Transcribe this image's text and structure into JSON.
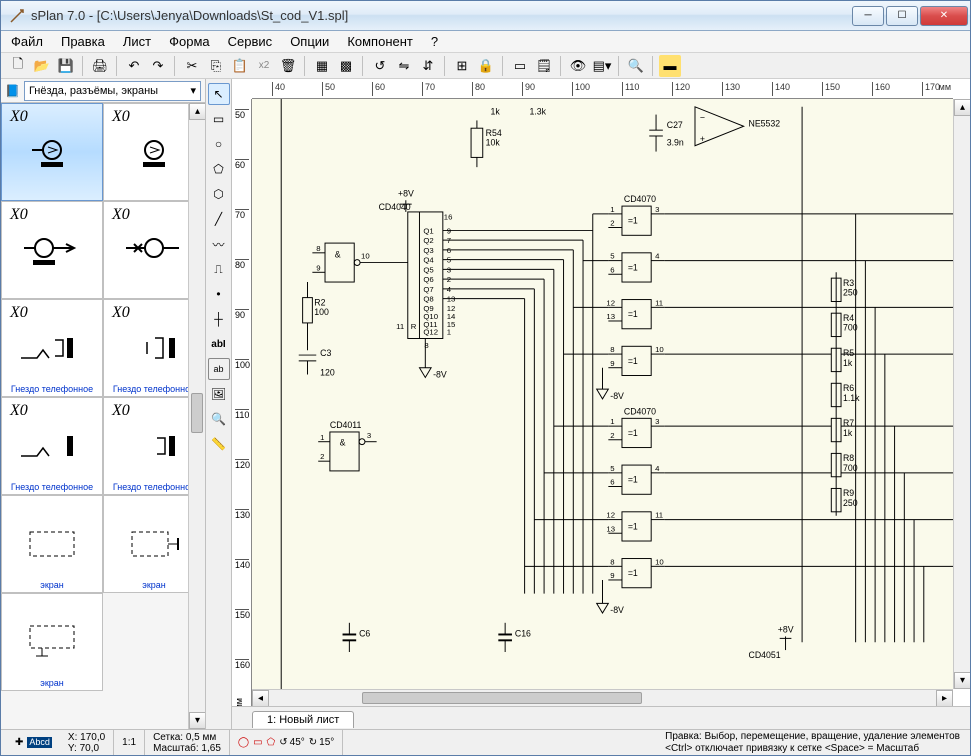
{
  "window": {
    "title": "sPlan 7.0 - [C:\\Users\\Jenya\\Downloads\\St_cod_V1.spl]"
  },
  "menu": {
    "items": [
      "Файл",
      "Правка",
      "Лист",
      "Форма",
      "Сервис",
      "Опции",
      "Компонент",
      "?"
    ]
  },
  "library": {
    "category": "Гнёзда, разъёмы, экраны",
    "items": [
      {
        "ref": "X0",
        "label": "",
        "selected": true
      },
      {
        "ref": "X0",
        "label": ""
      },
      {
        "ref": "X0",
        "label": ""
      },
      {
        "ref": "X0",
        "label": ""
      },
      {
        "ref": "X0",
        "label": "Гнездо телефонное"
      },
      {
        "ref": "X0",
        "label": "Гнездо телефонное"
      },
      {
        "ref": "X0",
        "label": "Гнездо телефонное"
      },
      {
        "ref": "X0",
        "label": "Гнездо телефонное"
      },
      {
        "ref": "",
        "label": "экран"
      },
      {
        "ref": "",
        "label": "экран"
      },
      {
        "ref": "",
        "label": "экран"
      }
    ]
  },
  "ruler": {
    "h_ticks": [
      "40",
      "50",
      "60",
      "70",
      "80",
      "90",
      "100",
      "110",
      "120",
      "130",
      "140",
      "150",
      "160",
      "170"
    ],
    "h_unit": "мм",
    "v_ticks": [
      "50",
      "60",
      "70",
      "80",
      "90",
      "100",
      "110",
      "120",
      "130",
      "140",
      "150",
      "160"
    ],
    "v_unit": "мм"
  },
  "tabs": {
    "active": "1: Новый лист"
  },
  "status": {
    "coord_x": "X: 170,0",
    "coord_y": "Y: 70,0",
    "zoom_ratio": "1:1",
    "grid": "Сетка: 0,5 мм",
    "scale": "Масштаб: 1,65",
    "angle1": "45°",
    "angle2": "15°",
    "hint1": "Правка: Выбор, перемещение, вращение, удаление элементов",
    "hint2": "<Ctrl> отключает привязку к сетке <Space> = Масштаб"
  },
  "schematic": {
    "r54": "R54",
    "r54v": "10k",
    "c27": "C27",
    "c27v": "3.9n",
    "ne5532": "NE5532",
    "v8p": "+8V",
    "v8m": "-8V",
    "cd4040": "CD4040",
    "cd4070": "CD4070",
    "cd4011": "CD4011",
    "cd4051": "CD4051",
    "r2": "R2",
    "r2v": "100",
    "c3": "C3",
    "c3v": "120",
    "r3": "R3",
    "r3v": "250",
    "r4": "R4",
    "r4v": "700",
    "r5": "R5",
    "r5v": "1k",
    "r6": "R6",
    "r6v": "1.1k",
    "r7": "R7",
    "r7v": "1k",
    "r8": "R8",
    "r8v": "700",
    "r9": "R9",
    "r9v": "250",
    "c6": "C6",
    "c16": "C16",
    "eq": "=1",
    "and": "&",
    "pins_cd4040_left_top": "16",
    "pins_cd4040_left_bot": "11",
    "pins_cd4040_bot": "8",
    "small_1k": "1k",
    "small_13k": "1.3k",
    "pm": "−",
    "pp": "+"
  }
}
